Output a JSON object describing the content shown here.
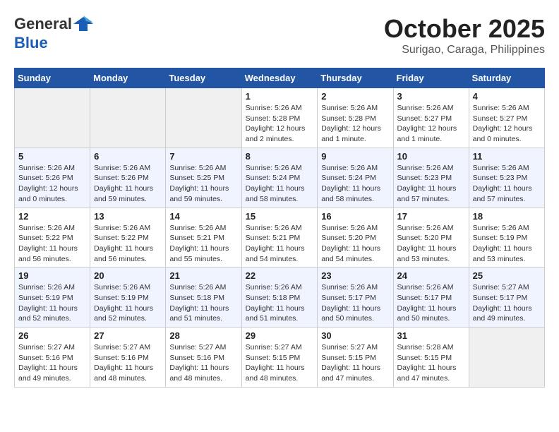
{
  "header": {
    "logo_general": "General",
    "logo_blue": "Blue",
    "month": "October 2025",
    "location": "Surigao, Caraga, Philippines"
  },
  "weekdays": [
    "Sunday",
    "Monday",
    "Tuesday",
    "Wednesday",
    "Thursday",
    "Friday",
    "Saturday"
  ],
  "weeks": [
    [
      {
        "day": "",
        "info": ""
      },
      {
        "day": "",
        "info": ""
      },
      {
        "day": "",
        "info": ""
      },
      {
        "day": "1",
        "info": "Sunrise: 5:26 AM\nSunset: 5:28 PM\nDaylight: 12 hours and 2 minutes."
      },
      {
        "day": "2",
        "info": "Sunrise: 5:26 AM\nSunset: 5:28 PM\nDaylight: 12 hours and 1 minute."
      },
      {
        "day": "3",
        "info": "Sunrise: 5:26 AM\nSunset: 5:27 PM\nDaylight: 12 hours and 1 minute."
      },
      {
        "day": "4",
        "info": "Sunrise: 5:26 AM\nSunset: 5:27 PM\nDaylight: 12 hours and 0 minutes."
      }
    ],
    [
      {
        "day": "5",
        "info": "Sunrise: 5:26 AM\nSunset: 5:26 PM\nDaylight: 12 hours and 0 minutes."
      },
      {
        "day": "6",
        "info": "Sunrise: 5:26 AM\nSunset: 5:26 PM\nDaylight: 11 hours and 59 minutes."
      },
      {
        "day": "7",
        "info": "Sunrise: 5:26 AM\nSunset: 5:25 PM\nDaylight: 11 hours and 59 minutes."
      },
      {
        "day": "8",
        "info": "Sunrise: 5:26 AM\nSunset: 5:24 PM\nDaylight: 11 hours and 58 minutes."
      },
      {
        "day": "9",
        "info": "Sunrise: 5:26 AM\nSunset: 5:24 PM\nDaylight: 11 hours and 58 minutes."
      },
      {
        "day": "10",
        "info": "Sunrise: 5:26 AM\nSunset: 5:23 PM\nDaylight: 11 hours and 57 minutes."
      },
      {
        "day": "11",
        "info": "Sunrise: 5:26 AM\nSunset: 5:23 PM\nDaylight: 11 hours and 57 minutes."
      }
    ],
    [
      {
        "day": "12",
        "info": "Sunrise: 5:26 AM\nSunset: 5:22 PM\nDaylight: 11 hours and 56 minutes."
      },
      {
        "day": "13",
        "info": "Sunrise: 5:26 AM\nSunset: 5:22 PM\nDaylight: 11 hours and 56 minutes."
      },
      {
        "day": "14",
        "info": "Sunrise: 5:26 AM\nSunset: 5:21 PM\nDaylight: 11 hours and 55 minutes."
      },
      {
        "day": "15",
        "info": "Sunrise: 5:26 AM\nSunset: 5:21 PM\nDaylight: 11 hours and 54 minutes."
      },
      {
        "day": "16",
        "info": "Sunrise: 5:26 AM\nSunset: 5:20 PM\nDaylight: 11 hours and 54 minutes."
      },
      {
        "day": "17",
        "info": "Sunrise: 5:26 AM\nSunset: 5:20 PM\nDaylight: 11 hours and 53 minutes."
      },
      {
        "day": "18",
        "info": "Sunrise: 5:26 AM\nSunset: 5:19 PM\nDaylight: 11 hours and 53 minutes."
      }
    ],
    [
      {
        "day": "19",
        "info": "Sunrise: 5:26 AM\nSunset: 5:19 PM\nDaylight: 11 hours and 52 minutes."
      },
      {
        "day": "20",
        "info": "Sunrise: 5:26 AM\nSunset: 5:19 PM\nDaylight: 11 hours and 52 minutes."
      },
      {
        "day": "21",
        "info": "Sunrise: 5:26 AM\nSunset: 5:18 PM\nDaylight: 11 hours and 51 minutes."
      },
      {
        "day": "22",
        "info": "Sunrise: 5:26 AM\nSunset: 5:18 PM\nDaylight: 11 hours and 51 minutes."
      },
      {
        "day": "23",
        "info": "Sunrise: 5:26 AM\nSunset: 5:17 PM\nDaylight: 11 hours and 50 minutes."
      },
      {
        "day": "24",
        "info": "Sunrise: 5:26 AM\nSunset: 5:17 PM\nDaylight: 11 hours and 50 minutes."
      },
      {
        "day": "25",
        "info": "Sunrise: 5:27 AM\nSunset: 5:17 PM\nDaylight: 11 hours and 49 minutes."
      }
    ],
    [
      {
        "day": "26",
        "info": "Sunrise: 5:27 AM\nSunset: 5:16 PM\nDaylight: 11 hours and 49 minutes."
      },
      {
        "day": "27",
        "info": "Sunrise: 5:27 AM\nSunset: 5:16 PM\nDaylight: 11 hours and 48 minutes."
      },
      {
        "day": "28",
        "info": "Sunrise: 5:27 AM\nSunset: 5:16 PM\nDaylight: 11 hours and 48 minutes."
      },
      {
        "day": "29",
        "info": "Sunrise: 5:27 AM\nSunset: 5:15 PM\nDaylight: 11 hours and 48 minutes."
      },
      {
        "day": "30",
        "info": "Sunrise: 5:27 AM\nSunset: 5:15 PM\nDaylight: 11 hours and 47 minutes."
      },
      {
        "day": "31",
        "info": "Sunrise: 5:28 AM\nSunset: 5:15 PM\nDaylight: 11 hours and 47 minutes."
      },
      {
        "day": "",
        "info": ""
      }
    ]
  ]
}
